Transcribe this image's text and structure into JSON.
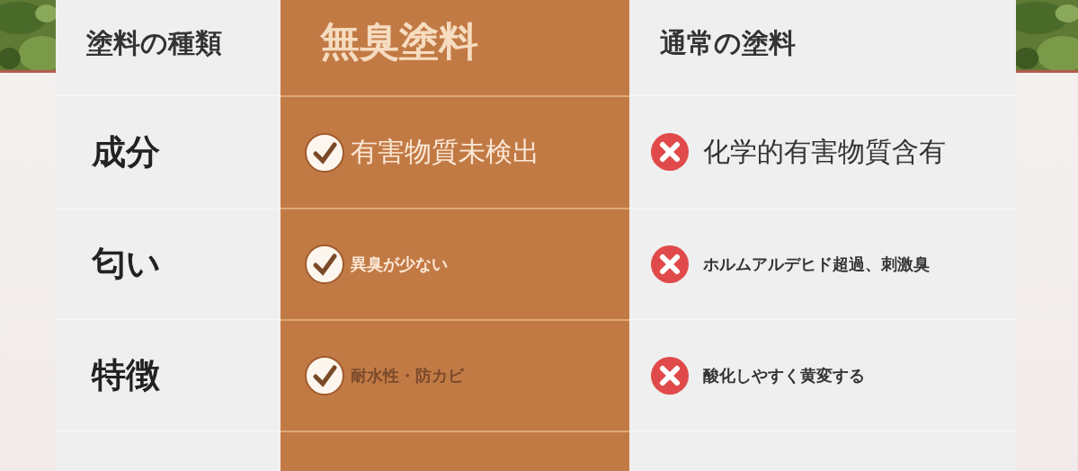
{
  "table": {
    "columns": [
      {
        "label": "塗料の種類",
        "kind": "plain"
      },
      {
        "label": "無臭塗料",
        "kind": "featured"
      },
      {
        "label": "通常の塗料",
        "kind": "plain"
      }
    ],
    "rows": [
      {
        "label": "成分",
        "good": {
          "text": "有害物質未検出",
          "kind": "headline",
          "color": "#fbe8d6"
        },
        "bad": {
          "text": "化学的有害物質含有",
          "kind": "headline"
        }
      },
      {
        "label": "匂い",
        "good": {
          "text": "異臭が少ない",
          "kind": "note",
          "color": "#fbe8d6"
        },
        "bad": {
          "text": "ホルムアルデヒド超過、刺激臭",
          "kind": "note"
        }
      },
      {
        "label": "特徴",
        "good": {
          "text": "耐水性・防カビ",
          "kind": "note",
          "color": "#7a4a2a"
        },
        "bad": {
          "text": "酸化しやすく黄変する",
          "kind": "note"
        }
      },
      {
        "kind": "cut"
      }
    ]
  }
}
